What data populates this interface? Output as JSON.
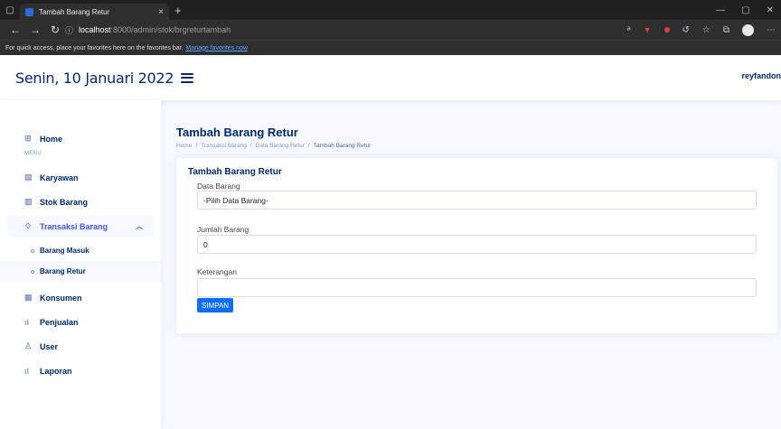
{
  "browser": {
    "tab_title": "Tambah Barang Retur",
    "tab_close": "×",
    "new_tab": "+",
    "url_host": "localhost",
    "url_path": ":8000/admin/stok/brgreturtambah",
    "favbar_text": "For quick access, place your favorites here on the favorites bar.",
    "favbar_link": "Manage favorites now"
  },
  "header": {
    "date": "Senin, 10 Januari 2022",
    "user": "reyfandon"
  },
  "sidebar": {
    "home": "Home",
    "menu_heading": "MENU",
    "items": [
      {
        "label": "Karyawan"
      },
      {
        "label": "Stok Barang"
      },
      {
        "label": "Transaksi Barang"
      },
      {
        "label": "Konsumen"
      },
      {
        "label": "Penjualan"
      },
      {
        "label": "User"
      },
      {
        "label": "Laporan"
      }
    ],
    "sub_items": [
      {
        "label": "Barang Masuk"
      },
      {
        "label": "Barang Retur"
      }
    ]
  },
  "main": {
    "page_title": "Tambah Barang Retur",
    "breadcrumb": [
      "Home",
      "Transaksi Barang",
      "Data Barang Retur",
      "Tambah Barang Retur"
    ],
    "breadcrumb_sep": "/",
    "card_title": "Tambah Barang Retur",
    "form": {
      "data_barang_label": "Data Barang",
      "data_barang_value": "-Pilih Data Barang-",
      "jumlah_label": "Jumlah Barang",
      "jumlah_value": "0",
      "keterangan_label": "Keterangan",
      "keterangan_value": "",
      "submit_label": "SIMPAN"
    }
  },
  "colors": {
    "primary": "#4154f1",
    "navy": "#012970",
    "button": "#0d6efd"
  }
}
